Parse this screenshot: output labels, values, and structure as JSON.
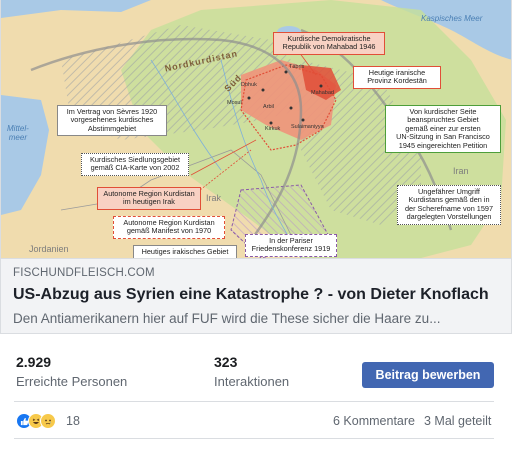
{
  "map": {
    "seas": {
      "caspian": "Kaspisches Meer",
      "mediterranean": "Mittel-\nmeer"
    },
    "countries": {
      "iran": "Iran",
      "irak": "Irak",
      "jordanien": "Jordanien"
    },
    "regions": {
      "nordkurdistan": "Nordkurdistan",
      "sued": "Süd"
    },
    "cities": {
      "tabriz": "Täbris",
      "mahabad": "Mahabad",
      "dohuk": "Dohuk",
      "mossul": "Mosul",
      "erbil": "Arbil",
      "kirkuk": "Kirkuk",
      "sulaimaniyya": "Sulaimaniyya"
    },
    "legend": {
      "mahabad_republic": "Kurdische Demokratische\nRepublik von Mahabad 1946",
      "iranian_kurdistan": "Heutige iranische\nProvinz Kordestān",
      "sevres": "Im Vertrag von Sèvres 1920\nvorgesehenes kurdisches\nAbstimmgebiet",
      "un_petition": "Von kurdischer Seite\nbeanspruchtes Gebiet\ngemäß einer zur ersten\nUN-Sitzung in San Francisco\n1945 eingereichten Petition",
      "cia_map": "Kurdisches Siedlungsgebiet\ngemäß CIA-Karte von 2002",
      "autonomous_today": "Autonome Region Kurdistan\nim heutigen Irak",
      "sherefname": "Ungefährer Umgriff\nKurdistans gemäß den in\nder Scherefname von 1597\ndargelegten Vorstellungen",
      "manifest_1970": "Autonome Region Kurdistan\ngemäß Manifest von 1970",
      "paris_1919": "In der Pariser\nFriedenskonferenz 1919",
      "iraqi_today": "Heutiges irakisches Gebiet"
    }
  },
  "link": {
    "domain": "FISCHUNDFLEISCH.COM",
    "title": "US-Abzug aus Syrien eine Katastrophe ? - von Dieter Knoflach",
    "description": "Den Antiamerikanern hier auf FUF wird die These sicher die Haare zu..."
  },
  "stats": {
    "reach_value": "2.929",
    "reach_label": "Erreichte Personen",
    "interactions_value": "323",
    "interactions_label": "Interaktionen",
    "boost_label": "Beitrag bewerben"
  },
  "reactions": {
    "icons": [
      "like-icon",
      "haha-icon",
      "sad-icon"
    ],
    "count": "18",
    "comments": "6 Kommentare",
    "shares": "3 Mal geteilt"
  },
  "colors": {
    "boost_button": "#4267b2",
    "like": "#1877f2",
    "kurdistan_red": "#e14e37",
    "green_zone": "#c6e09a"
  }
}
